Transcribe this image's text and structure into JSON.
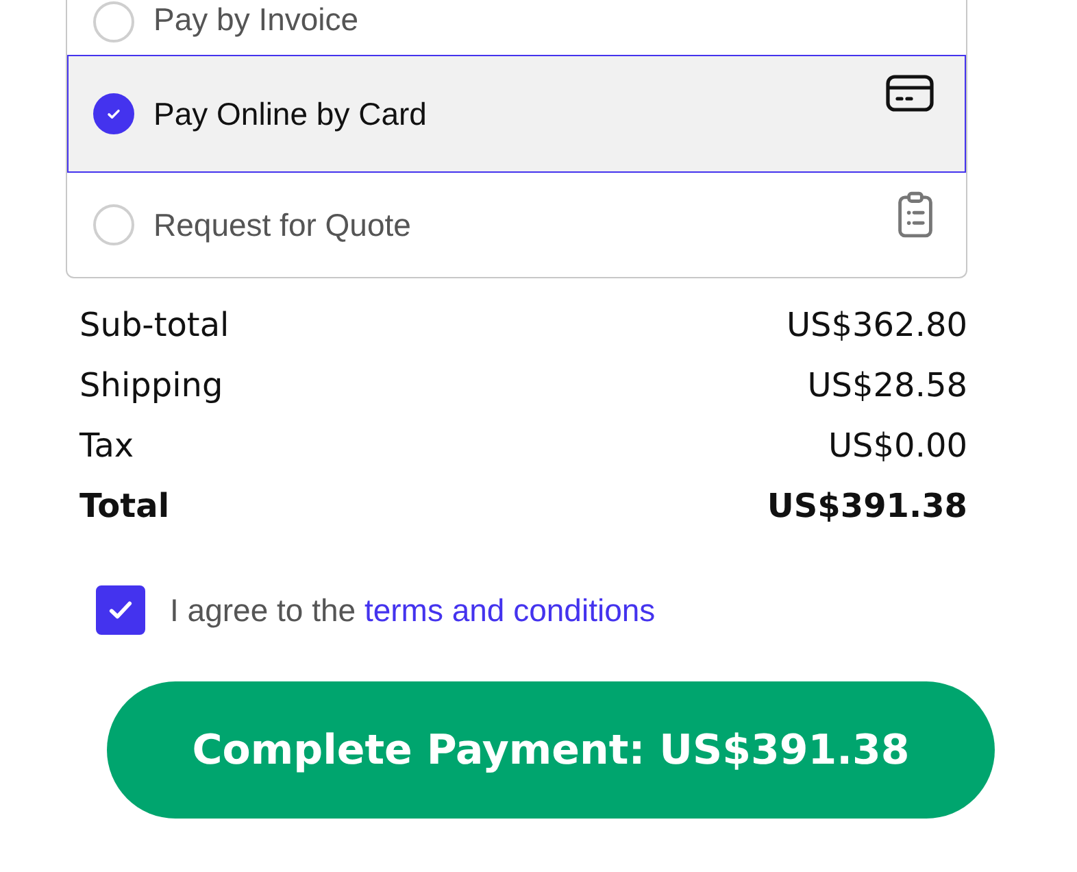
{
  "payment_options": [
    {
      "kind": "invoice",
      "label": "Pay by Invoice",
      "selected": false
    },
    {
      "kind": "card",
      "label": "Pay Online by Card",
      "selected": true
    },
    {
      "kind": "quote",
      "label": "Request for Quote",
      "selected": false
    }
  ],
  "summary": [
    {
      "kind": "line",
      "label": "Sub-total",
      "amount": "US$362.80"
    },
    {
      "kind": "line",
      "label": "Shipping",
      "amount": "US$28.58"
    },
    {
      "kind": "line",
      "label": "Tax",
      "amount": "US$0.00"
    },
    {
      "kind": "total",
      "label": "Total",
      "amount": "US$391.38"
    }
  ],
  "terms": {
    "checked": true,
    "text": "I agree to the",
    "link": "terms and conditions"
  },
  "submit_button": "Complete Payment: US$391.38"
}
